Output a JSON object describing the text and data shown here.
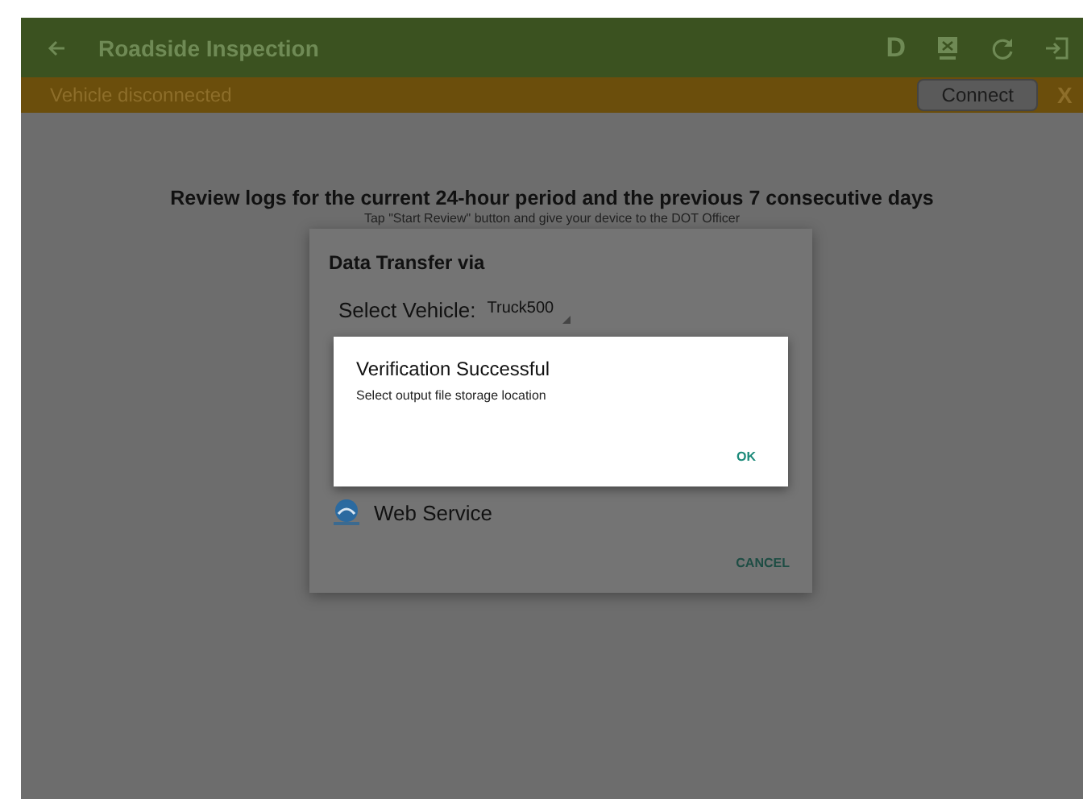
{
  "toolbar": {
    "title": "Roadside Inspection",
    "actions": [
      "D"
    ]
  },
  "banner": {
    "message": "Vehicle disconnected",
    "button": "Connect",
    "close": "X"
  },
  "content": {
    "heading": "Review logs for the current 24-hour period and the previous 7 consecutive days",
    "subheading": "Tap \"Start Review\" button and give your device to the DOT Officer"
  },
  "transfer_dialog": {
    "title": "Data Transfer via",
    "vehicle_label": "Select Vehicle:",
    "vehicle_value": "Truck500",
    "options": [
      "Web Service"
    ],
    "cancel": "CANCEL"
  },
  "alert": {
    "title": "Verification Successful",
    "message": "Select output file storage location",
    "ok": "OK"
  }
}
